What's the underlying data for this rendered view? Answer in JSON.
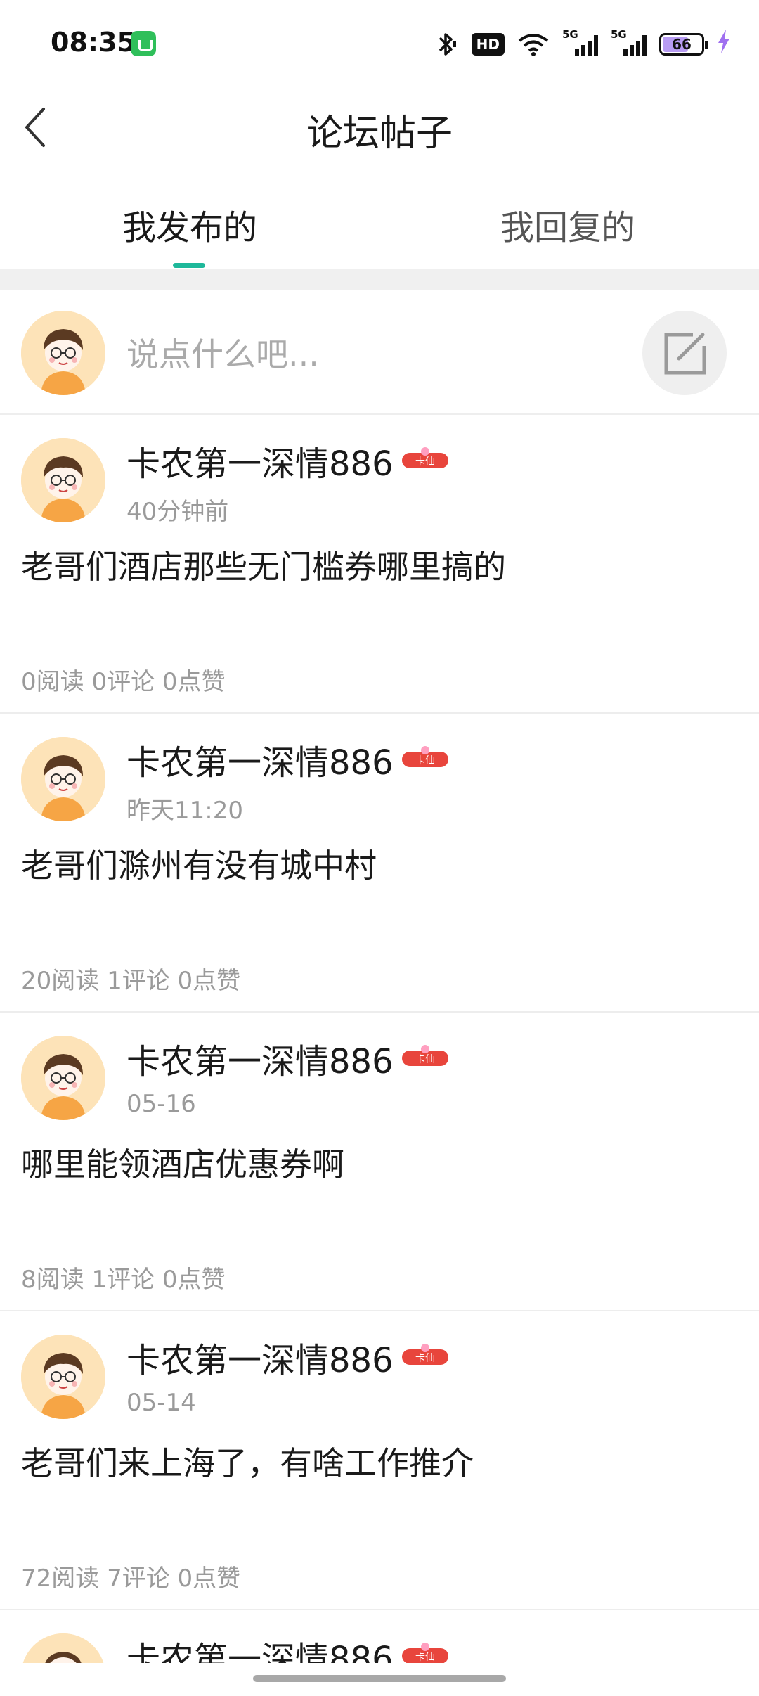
{
  "status_bar": {
    "time": "08:35",
    "bluetooth_icon": "bluetooth-icon",
    "hd_label": "HD",
    "signal_1_label": "5G",
    "signal_2_label": "5G",
    "battery_level": "66",
    "colors": {
      "battery_fill": "#b89cf3",
      "charge": "#a070f0",
      "app_icon": "#2fbf5a"
    }
  },
  "header": {
    "title": "论坛帖子",
    "back_icon": "chevron-left-icon"
  },
  "tabs": [
    {
      "label": "我发布的",
      "active": true
    },
    {
      "label": "我回复的",
      "active": false
    }
  ],
  "accent_color": "#1eb89a",
  "compose": {
    "placeholder": "说点什么吧...",
    "edit_icon": "edit-icon"
  },
  "posts": [
    {
      "author": "卡农第一深情886",
      "badge": "卡仙",
      "time": "40分钟前",
      "content": "老哥们酒店那些无门槛券哪里搞的",
      "stats": "0阅读 0评论 0点赞"
    },
    {
      "author": "卡农第一深情886",
      "badge": "卡仙",
      "time": "昨天11:20",
      "content": "老哥们滁州有没有城中村",
      "stats": "20阅读 1评论 0点赞"
    },
    {
      "author": "卡农第一深情886",
      "badge": "卡仙",
      "time": "05-16",
      "content": "哪里能领酒店优惠券啊",
      "stats": "8阅读 1评论 0点赞"
    },
    {
      "author": "卡农第一深情886",
      "badge": "卡仙",
      "time": "05-14",
      "content": "老哥们来上海了，有啥工作推介",
      "stats": "72阅读 7评论 0点赞"
    },
    {
      "author": "卡农第一深情886",
      "badge": "卡仙",
      "time": "",
      "content": "",
      "stats": ""
    }
  ]
}
